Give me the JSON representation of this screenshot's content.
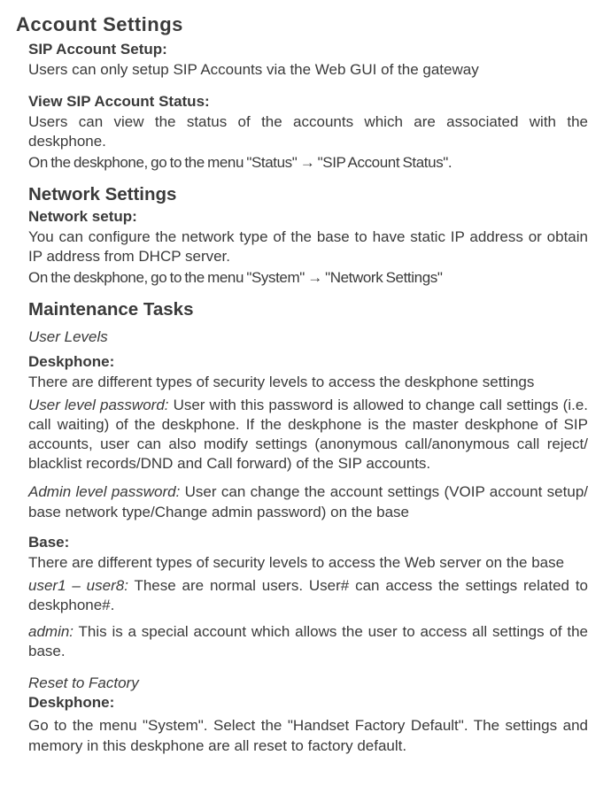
{
  "account_settings": {
    "title": "Account Settings",
    "sip_setup_heading": "SIP Account Setup:",
    "sip_setup_body": "Users can only setup SIP Accounts via the Web GUI of the gateway",
    "view_sip_heading": "View SIP Account Status:",
    "view_sip_body1": "Users can view the status of the accounts which are associated with the deskphone.",
    "view_sip_body2": "On the deskphone, go to the menu \"Status\" → \"SIP Account Status\"."
  },
  "network_settings": {
    "title": "Network Settings",
    "setup_heading": "Network setup:",
    "setup_body1": "You can configure the network type of the base to have static IP address or obtain IP address from DHCP server.",
    "setup_body2": "On the deskphone, go to the menu \"System\" → \"Network Settings\""
  },
  "maintenance": {
    "title": "Maintenance Tasks",
    "user_levels_heading": "User Levels",
    "deskphone_heading": "Deskphone:",
    "deskphone_body": "There are different types of security levels to access the deskphone settings",
    "user_level_pw_lead": "User level password:",
    "user_level_pw_body": " User with this password is allowed to change call settings (i.e. call waiting) of the deskphone. If the deskphone is the master deskphone of SIP accounts, user can also modify settings (anonymous call/anonymous call reject/ blacklist records/DND and Call forward) of the SIP accounts.",
    "admin_pw_lead": "Admin level password:",
    "admin_pw_body": " User can change the account settings (VOIP account setup/ base network type/Change admin password) on the base",
    "base_heading": "Base:",
    "base_body": "There are different types of security levels to access the Web server on the base",
    "user1_8_lead": "user1 – user8:",
    "user1_8_body": " These are normal users. User# can access the settings related to deskphone#.",
    "admin_lead": "admin:",
    "admin_body": " This is a special account which allows the user to access all settings of the base.",
    "reset_heading": "Reset to Factory",
    "reset_deskphone_heading": "Deskphone:",
    "reset_deskphone_body": "Go to the menu \"System\". Select the \"Handset Factory Default\".  The settings and memory in this deskphone are all reset to factory default."
  }
}
